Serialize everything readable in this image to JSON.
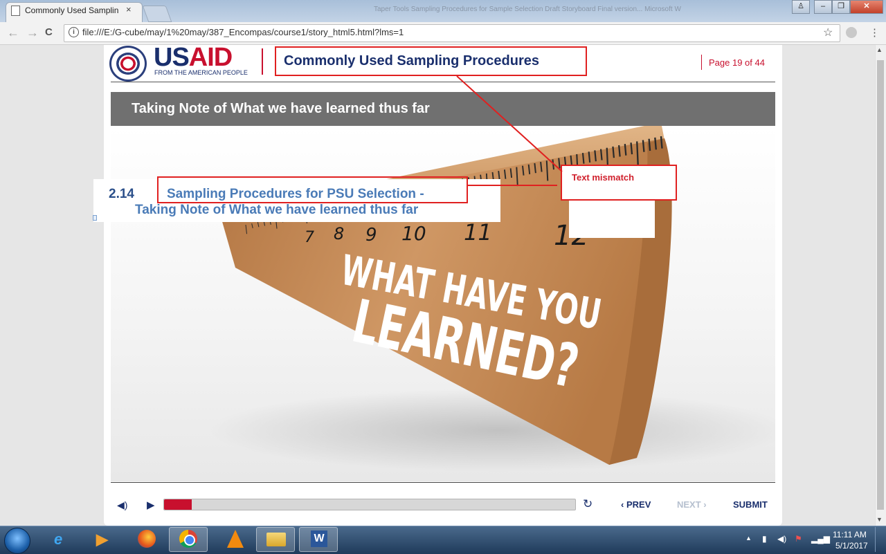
{
  "browser": {
    "tab_title": "Commonly Used Samplin",
    "background_titles": "Taper Tools    Sampling Procedures for Sample Selection Draft Storyboard Final version...    Microsoft W",
    "url": "file:///E:/G-cube/may/1%20may/387_Encompas/course1/story_html5.html?lms=1",
    "buttons": {
      "back": "←",
      "forward": "→",
      "reload": "C",
      "star": "☆",
      "menu": "⋮",
      "minimize": "–",
      "maximize": "❐",
      "close": "✕",
      "tab_close": "×",
      "user": "♙"
    }
  },
  "course": {
    "logo": {
      "word_us": "US",
      "word_aid": "AID",
      "tagline": "FROM THE AMERICAN PEOPLE"
    },
    "title": "Commonly Used Sampling Procedures",
    "page": {
      "text": "Page 19 of  44",
      "current": 19,
      "total": 44
    }
  },
  "slide": {
    "heading": "Taking Note of What we have learned thus far",
    "overlay": {
      "number": "2.14",
      "line1": "Sampling Procedures for PSU Selection -",
      "line2": "Taking Note of What we have learned thus far"
    },
    "annotation": {
      "text": "Text mismatch"
    },
    "image": {
      "ruler_numbers": [
        "7",
        "8",
        "9",
        "10",
        "11",
        "12"
      ],
      "text_line1": "WHAT HAVE YOU",
      "text_line2": "LEARNED?"
    }
  },
  "player": {
    "progress": 0.067,
    "prev_label": "PREV",
    "next_label": "NEXT",
    "submit_label": "SUBMIT",
    "prev_icon": "‹",
    "next_icon": "›"
  },
  "taskbar": {
    "time": "11:11 AM",
    "date": "5/1/2017",
    "apps": [
      "ie",
      "media-player",
      "firefox",
      "chrome",
      "vlc",
      "file-explorer",
      "word"
    ]
  },
  "colors": {
    "usaid_blue": "#1a2f6d",
    "usaid_red": "#c8102e",
    "annotation_red": "#e02020",
    "overlay_blue": "#4a7bb7",
    "wood": "#c9935f"
  }
}
